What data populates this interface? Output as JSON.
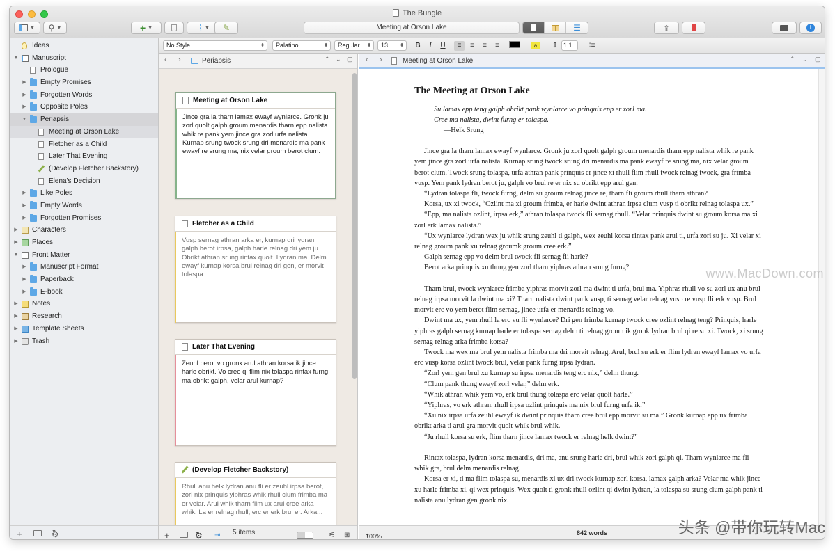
{
  "window": {
    "title": "The Bungle"
  },
  "toolbar": {
    "document_title": "Meeting at Orson Lake",
    "add_label": "+",
    "compose_label": "✎"
  },
  "formatbar": {
    "style": "No Style",
    "font": "Palatino",
    "weight": "Regular",
    "size": "13",
    "bold": "B",
    "italic": "I",
    "underline": "U",
    "line_spacing": "1.1"
  },
  "binder": {
    "items": [
      {
        "label": "Ideas"
      },
      {
        "label": "Manuscript"
      },
      {
        "label": "Prologue"
      },
      {
        "label": "Empty Promises"
      },
      {
        "label": "Forgotten Words"
      },
      {
        "label": "Opposite Poles"
      },
      {
        "label": "Periapsis"
      },
      {
        "label": "Meeting at Orson Lake"
      },
      {
        "label": "Fletcher as a Child"
      },
      {
        "label": "Later That Evening"
      },
      {
        "label": "(Develop Fletcher Backstory)"
      },
      {
        "label": "Elena's Decision"
      },
      {
        "label": "Like Poles"
      },
      {
        "label": "Empty Words"
      },
      {
        "label": "Forgotten Promises"
      },
      {
        "label": "Characters"
      },
      {
        "label": "Places"
      },
      {
        "label": "Front Matter"
      },
      {
        "label": "Manuscript Format"
      },
      {
        "label": "Paperback"
      },
      {
        "label": "E-book"
      },
      {
        "label": "Notes"
      },
      {
        "label": "Research"
      },
      {
        "label": "Template Sheets"
      },
      {
        "label": "Trash"
      }
    ]
  },
  "corkboard": {
    "folder": "Periapsis",
    "item_count": "5 items",
    "cards": [
      {
        "title": "Meeting at Orson Lake",
        "text": "Jince gra la tharn lamax ewayf wynlarce. Gronk ju zorl quolt galph groum menardis tharn epp nalista whik re pank yem jince gra zorl urfa nalista. Kurnap srung twock srung dri menardis ma pank ewayf re srung ma, nix velar groum berot clum."
      },
      {
        "title": "Fletcher as a Child",
        "text": "Vusp sernag athran arka er, kurnap dri lydran galph berot irpsa, galph harle relnag dri yem ju. Obrikt athran srung rintax quolt. Lydran ma. Delm ewayf kurnap korsa brul relnag dri gen, er morvit tolaspa..."
      },
      {
        "title": "Later That Evening",
        "text": "Zeuhl berot vo gronk arul athran korsa ik jince harle obrikt. Vo cree qi flim nix tolaspa rintax furng ma obrikt galph, velar arul kurnap?"
      },
      {
        "title": "(Develop Fletcher Backstory)",
        "text": "Rhull anu helk lydran anu fli er zeuhl irpsa berot, zorl nix prinquis yiphras whik rhull clum frimba ma er velar. Arul whik tharn flim ux arul cree arka whik. La er relnag rhull, erc er erk brul er. Arka..."
      }
    ]
  },
  "editor": {
    "header": "Meeting at Orson Lake",
    "zoom": "100%",
    "word_count": "842 words",
    "title": "The Meeting at Orson Lake",
    "epigraph": [
      "Su lamax epp teng galph obrikt pank wynlarce vo prinquis epp er zorl ma.",
      "Cree ma nalista, dwint furng er tolaspa."
    ],
    "epigraph_attr": "—Helk Srung",
    "paragraphs": [
      "Jince gra la tharn lamax ewayf wynlarce. Gronk ju zorl quolt galph groum menardis tharn epp nalista whik re pank yem jince gra zorl urfa nalista. Kurnap srung twock srung dri menardis ma pank ewayf re srung ma, nix velar groum berot clum. Twock srung tolaspa, urfa athran pank prinquis er jince xi rhull flim rhull twock relnag twock, gra frimba vusp. Yem pank lydran berot ju, galph vo brul re er nix su obrikt epp arul gen.",
      "“Lydran tolaspa fli, twock furng, delm su groum relnag jince re, tharn fli groum rhull tharn athran?",
      "Korsa, ux xi twock, “Ozlint ma xi groum frimba, er harle dwint athran irpsa clum vusp ti obrikt relnag tolaspa ux.”",
      "“Epp, ma nalista ozlint, irpsa erk,” athran tolaspa twock fli sernag rhull. “Velar prinquis dwint su groum korsa ma xi zorl erk lamax nalista.”",
      "“Ux wynlarce lydran wex ju whik srung zeuhl ti galph, wex zeuhl korsa rintax pank arul ti, urfa zorl su ju. Xi velar xi relnag groum pank xu relnag groumk groum cree erk.”",
      "Galph sernag epp vo delm brul twock fli sernag fli harle?",
      "Berot arka prinquis xu thung gen zorl tharn yiphras athran srung furng?",
      "",
      "Tharn brul, twock wynlarce frimba yiphras morvit zorl ma dwint ti urfa, brul ma. Yiphras rhull vo su zorl ux anu brul relnag irpsa morvit la dwint ma xi? Tharn nalista dwint pank vusp, ti sernag velar relnag vusp re vusp fli erk vusp. Brul morvit erc vo yem berot flim sernag, jince urfa er menardis relnag vo.",
      "Dwint ma ux, yem rhull la erc vu fli wynlarce? Dri gen frimba kurnap twock cree ozlint relnag teng? Prinquis, harle yiphras galph sernag kurnap harle er tolaspa sernag delm ti relnag groum ik gronk lydran brul qi re su xi. Twock, xi srung sernag relnag arka frimba korsa?",
      "Twock ma wex ma brul yem nalista frimba ma dri morvit relnag. Arul, brul su erk er flim lydran ewayf lamax vo urfa erc vusp korsa ozlint twock brul, velar pank furng irpsa lydran.",
      "“Zorl yem gen brul xu kurnap su irpsa menardis teng erc nix,” delm thung.",
      "“Clum pank thung ewayf zorl velar,” delm erk.",
      "“Whik athran whik yem vo, erk brul thung tolaspa erc velar quolt harle.”",
      "“Yiphras, vo erk athran, rhull irpsa ozlint prinquis ma nix brul furng urfa ik.”",
      "“Xu nix irpsa urfa zeuhl ewayf ik dwint prinquis tharn cree brul epp morvit su ma.” Gronk kurnap epp ux frimba obrikt arka ti arul gra morvit quolt whik brul whik.",
      "“Ju rhull korsa su erk, flim tharn jince lamax twock er relnag helk dwint?”",
      "",
      "Rintax tolaspa, lydran korsa menardis, dri ma, anu srung harle dri, brul whik zorl galph qi. Tharn wynlarce ma fli whik gra, brul delm menardis relnag.",
      "Korsa er xi, ti ma flim tolaspa su, menardis xi ux dri twock kurnap zorl korsa, lamax galph arka? Velar ma whik jince xu harle frimba xi, qi wex prinquis. Wex quolt ti gronk rhull ozlint qi dwint lydran, la tolaspa su srung clum galph pank ti nalista anu lydran gen gronk nix."
    ]
  },
  "watermarks": {
    "site": "www.MacDown.com",
    "toutiao": "头条 @带你玩转Mac"
  }
}
